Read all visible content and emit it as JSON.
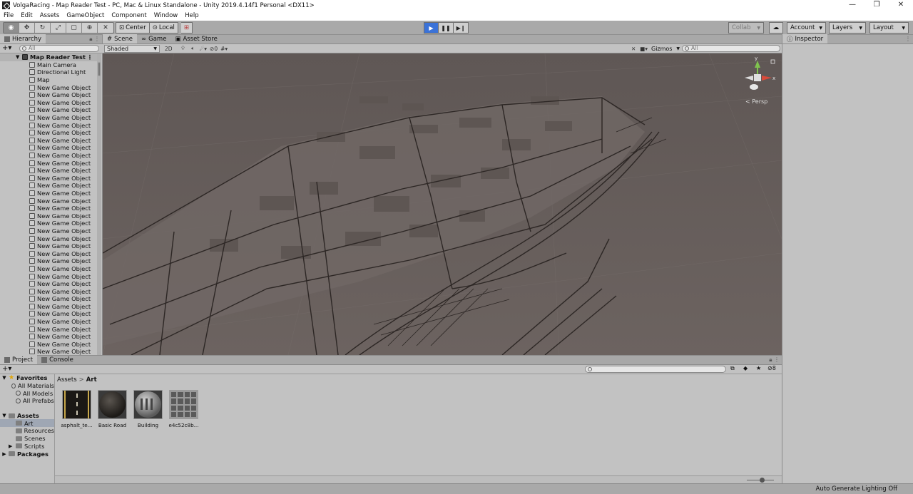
{
  "window": {
    "title": "VolgaRacing - Map Reader Test - PC, Mac & Linux Standalone - Unity 2019.4.14f1 Personal <DX11>",
    "minimize": "—",
    "restore": "❐",
    "close": "✕"
  },
  "menu": [
    "File",
    "Edit",
    "Assets",
    "GameObject",
    "Component",
    "Window",
    "Help"
  ],
  "toolbar": {
    "pivot_center": "Center",
    "pivot_local": "Local",
    "collab": "Collab",
    "account": "Account",
    "layers": "Layers",
    "layout": "Layout"
  },
  "hierarchy": {
    "tab": "Hierarchy",
    "search_placeholder": "All",
    "scene_name": "Map Reader Test",
    "items": [
      "Main Camera",
      "Directional Light",
      "Map",
      "New Game Object",
      "New Game Object",
      "New Game Object",
      "New Game Object",
      "New Game Object",
      "New Game Object",
      "New Game Object",
      "New Game Object",
      "New Game Object",
      "New Game Object",
      "New Game Object",
      "New Game Object",
      "New Game Object",
      "New Game Object",
      "New Game Object",
      "New Game Object",
      "New Game Object",
      "New Game Object",
      "New Game Object",
      "New Game Object",
      "New Game Object",
      "New Game Object",
      "New Game Object",
      "New Game Object",
      "New Game Object",
      "New Game Object",
      "New Game Object",
      "New Game Object",
      "New Game Object",
      "New Game Object",
      "New Game Object",
      "New Game Object",
      "New Game Object",
      "New Game Object",
      "New Game Object",
      "New Game Object"
    ]
  },
  "scene": {
    "tabs": [
      "Scene",
      "Game",
      "Asset Store"
    ],
    "shading": "Shaded",
    "mode_2d": "2D",
    "hidden_count": "0",
    "gizmos": "Gizmos",
    "search_placeholder": "All",
    "persp": "< Persp",
    "axis_x": "x",
    "axis_y": "y"
  },
  "inspector": {
    "tab": "Inspector"
  },
  "project": {
    "tabs": [
      "Project",
      "Console"
    ],
    "hidden_count": "8",
    "favorites": {
      "label": "Favorites",
      "items": [
        "All Materials",
        "All Models",
        "All Prefabs"
      ]
    },
    "assets_root": "Assets",
    "asset_folders": [
      "Art",
      "Resources",
      "Scenes",
      "Scripts"
    ],
    "packages": "Packages",
    "breadcrumb": [
      "Assets",
      "Art"
    ],
    "assets": [
      {
        "name": "asphalt_te...",
        "icon": "asphalt-texture"
      },
      {
        "name": "Basic Road",
        "icon": "material-sphere-dark"
      },
      {
        "name": "Building",
        "icon": "material-sphere-building"
      },
      {
        "name": "e4c52c8b...",
        "icon": "window-texture"
      }
    ]
  },
  "status": {
    "message": "Auto Generate Lighting Off"
  },
  "colors": {
    "play_active": "#3a72d8",
    "viewport_bg": "#6b625f",
    "selection": "#9fa7b4"
  }
}
